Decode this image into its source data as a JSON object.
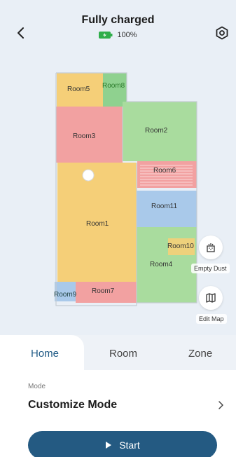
{
  "header": {
    "title": "Fully charged",
    "battery_text": "100%"
  },
  "map": {
    "rooms": [
      {
        "name": "Room5",
        "color": "#f5cf78"
      },
      {
        "name": "Room8",
        "color": "#8fd18f"
      },
      {
        "name": "Room3",
        "color": "#f2a1a1"
      },
      {
        "name": "Room2",
        "color": "#a9dc9e"
      },
      {
        "name": "Room6",
        "color": "#f2a1a1"
      },
      {
        "name": "Room11",
        "color": "#a9c9ea"
      },
      {
        "name": "Room1",
        "color": "#f5cf78"
      },
      {
        "name": "Room10",
        "color": "#f5cf78"
      },
      {
        "name": "Room4",
        "color": "#a9dc9e"
      },
      {
        "name": "Room9",
        "color": "#a9c9ea"
      },
      {
        "name": "Room7",
        "color": "#f2a1a1"
      }
    ],
    "empty_dust_label": "Empty Dust",
    "edit_map_label": "Edit Map"
  },
  "tabs": [
    {
      "label": "Home",
      "active": true
    },
    {
      "label": "Room",
      "active": false
    },
    {
      "label": "Zone",
      "active": false
    }
  ],
  "mode": {
    "caption": "Mode",
    "value": "Customize Mode"
  },
  "start_label": "Start",
  "colors": {
    "accent": "#245a82",
    "battery": "#2fae4a"
  }
}
